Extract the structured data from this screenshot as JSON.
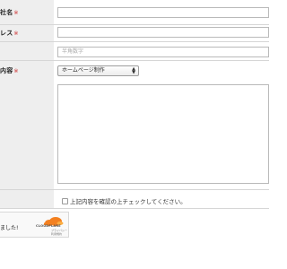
{
  "form": {
    "rows": [
      {
        "label": "社名",
        "required_mark": "※"
      },
      {
        "label": "レス",
        "required_mark": "※"
      },
      {
        "label": "",
        "required_mark": ""
      },
      {
        "label": "内容",
        "required_mark": "※"
      }
    ],
    "company_input": {
      "value": "",
      "placeholder": ""
    },
    "address_input": {
      "value": "",
      "placeholder": ""
    },
    "phone_input": {
      "value": "",
      "placeholder": "半角数字"
    },
    "inquiry_select": {
      "selected": "ホームページ制作"
    },
    "message_textarea": {
      "value": ""
    },
    "confirm_checkbox": {
      "checked": false,
      "label": "上記内容を確認の上チェックしてください。"
    }
  },
  "captcha": {
    "status_text": "ました!",
    "brand": "CLOUDFLARE",
    "links": [
      "プライバシー",
      "利用規約"
    ]
  },
  "colors": {
    "label_bg": "#eeeeee",
    "required": "#cc2b2b",
    "cloudflare_orange": "#f38020"
  },
  "icons": {
    "select_arrows": "updown-arrows-icon",
    "captcha_logo": "cloudflare-cloud-icon"
  }
}
